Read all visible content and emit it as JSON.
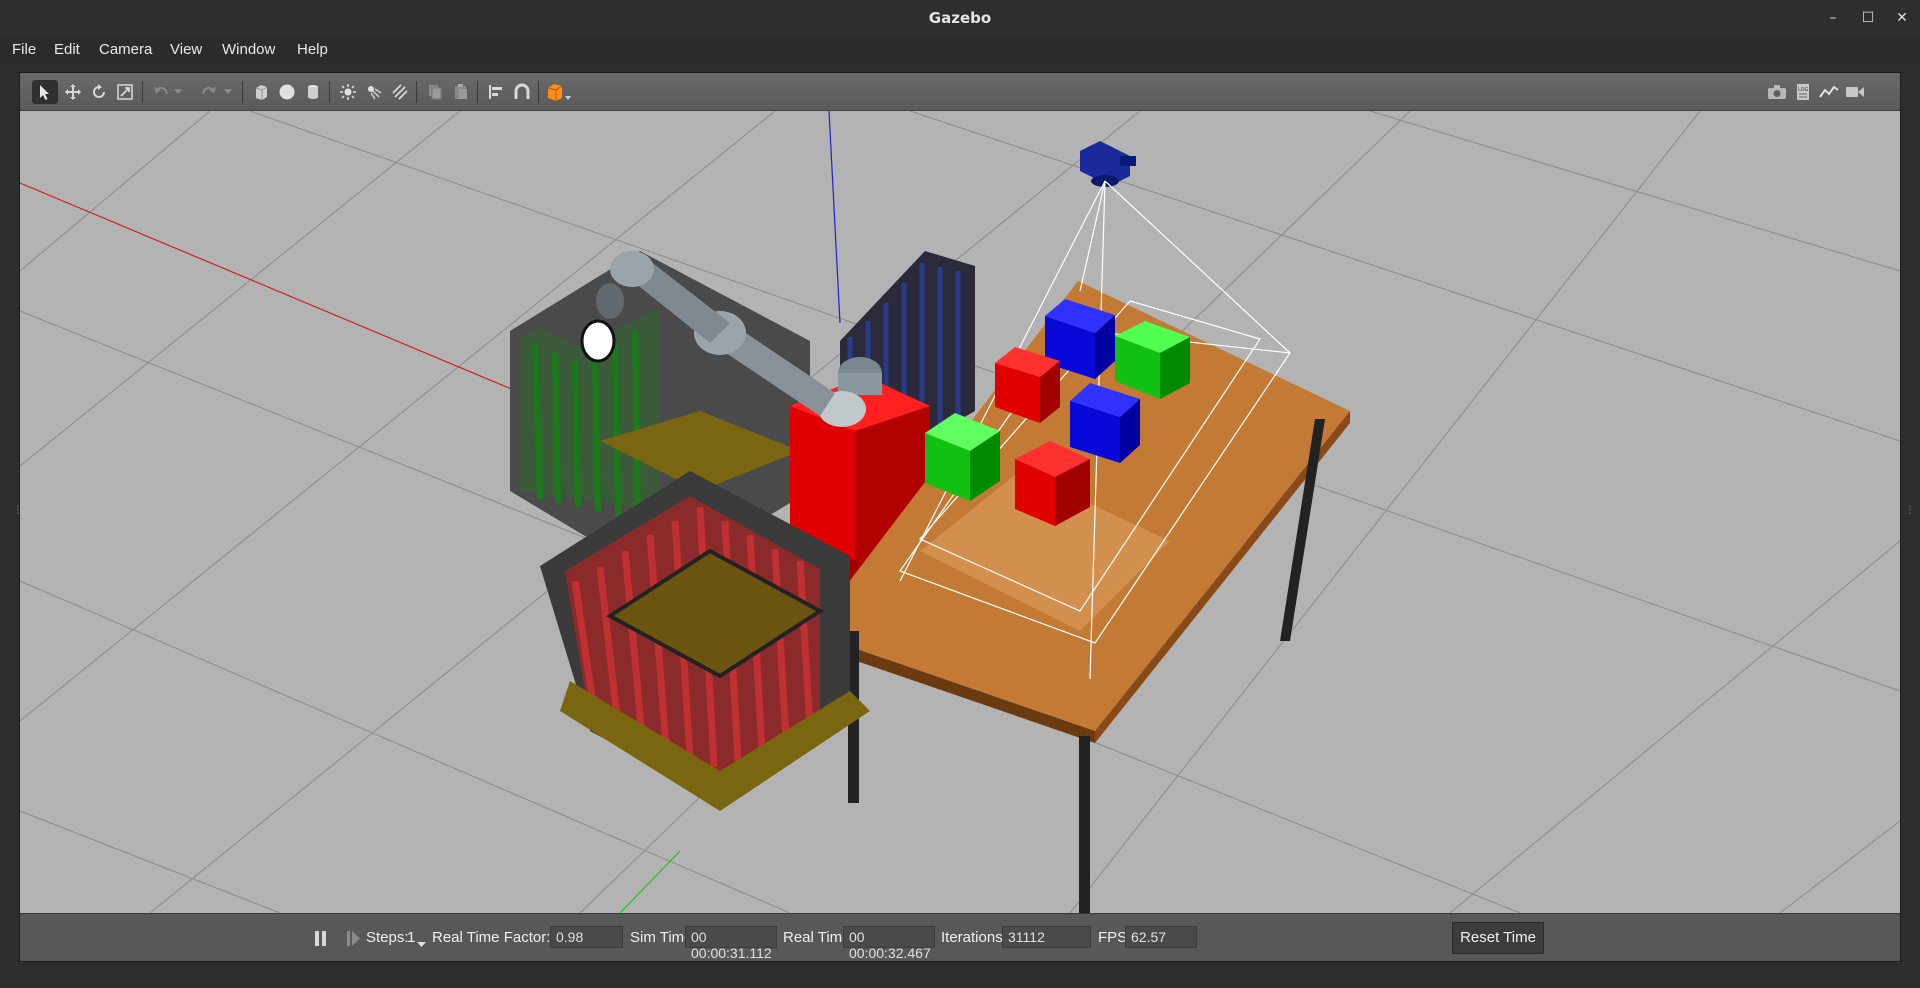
{
  "window": {
    "title": "Gazebo"
  },
  "menu": [
    "File",
    "Edit",
    "Camera",
    "View",
    "Window",
    "Help"
  ],
  "toolbar": {
    "tools": [
      "select-arrow-icon",
      "translate-icon",
      "rotate-icon",
      "scale-icon",
      "undo-icon",
      "undo-dropdown-icon",
      "redo-icon",
      "redo-dropdown-icon",
      "box-icon",
      "sphere-icon",
      "cylinder-icon",
      "point-light-icon",
      "spot-light-icon",
      "directional-light-icon",
      "copy-icon",
      "paste-icon",
      "align-icon",
      "snap-icon",
      "view-angle-icon"
    ],
    "right_tools": [
      "screenshot-icon",
      "log-icon",
      "plot-icon",
      "video-record-icon"
    ]
  },
  "bottom": {
    "steps_label": "Steps:",
    "steps_value": "1",
    "rtf_label": "Real Time Factor:",
    "rtf_value": "0.98",
    "sim_time_label": "Sim Time:",
    "sim_time_value": "00 00:00:31.112",
    "real_time_label": "Real Time:",
    "real_time_value": "00 00:00:32.467",
    "iterations_label": "Iterations:",
    "iterations_value": "31112",
    "fps_label": "FPS:",
    "fps_value": "62.57",
    "reset_label": "Reset Time"
  },
  "colors": {
    "ground": "#b4b4b4",
    "table": "#c8803e",
    "red": "#e00000",
    "green": "#10c010",
    "blue": "#0808d0"
  }
}
